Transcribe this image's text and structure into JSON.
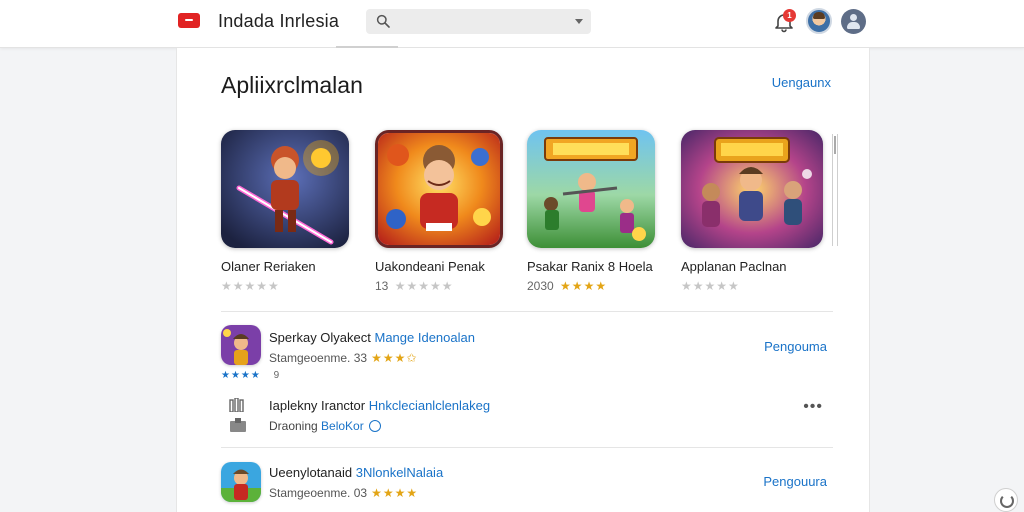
{
  "header": {
    "site_name": "Indada Inrlesia",
    "notification_count": "1"
  },
  "section": {
    "title": "Apliixrclmalan",
    "see_all": "Uengaunx"
  },
  "featured_apps": [
    {
      "title": "Olaner Reriaken",
      "rating_prefix": "",
      "stars_filled": 0,
      "stars_total": 5
    },
    {
      "title": "Uakondeani Penak",
      "rating_prefix": "13",
      "stars_filled": 0,
      "stars_total": 5
    },
    {
      "title": "Psakar Ranix 8 Hoela",
      "rating_prefix": "2030",
      "stars_filled": 4,
      "stars_total": 4
    },
    {
      "title": "Applanan Paclnan",
      "rating_prefix": "",
      "stars_filled": 0,
      "stars_total": 5
    }
  ],
  "list": [
    {
      "title_plain": "Sperkay Olyakect ",
      "title_accent": "Mange Idenoalan",
      "subtitle": "Stamgeoenme. 33",
      "stars": "★★★✩",
      "meta_stars": "★★★★",
      "meta_text": "9",
      "action": "Pengouma"
    },
    {
      "title_plain": "Iaplekny Iranctor ",
      "title_accent": "Hnkclecianlclenlakeg",
      "subtitle_plain": "Draoning ",
      "subtitle_accent": "BeloKor"
    },
    {
      "title_plain": "Ueenylotanaid ",
      "title_accent": "3NlonkelNalaia",
      "subtitle": "Stamgeoenme. 03",
      "stars": "★★★★",
      "action": "Pengouura"
    }
  ],
  "icons": {
    "search": "search-icon",
    "bell": "bell-icon",
    "more": "more-horizontal-icon",
    "help": "refresh-icon"
  },
  "colors": {
    "accent": "#1a73c8",
    "star": "#e3a516",
    "logo_red": "#e12323"
  }
}
